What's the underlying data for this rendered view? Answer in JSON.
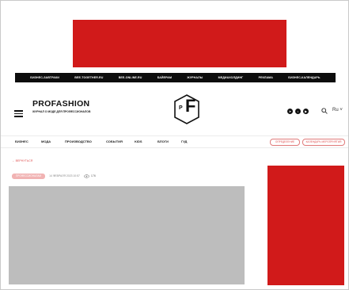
{
  "colors": {
    "ad_block": "#d11a1a",
    "topbar_bg": "#0d0d0d",
    "accent": "#e05555",
    "hero_placeholder": "#bdbdbd"
  },
  "topbar": {
    "links": [
      "БИЗНЕС-ЗАВТРАКИ",
      "BEE-TOGETHER.RU",
      "BEE-ONLINE.RU",
      "БАЙЕРАМ",
      "ЖУРНАЛЫ",
      "МЕДИАХОЛДИНГ",
      "РЕКЛАМА",
      "БИЗНЕС-КАЛЕНДАРЬ"
    ]
  },
  "header": {
    "logo_title": "PROFASHION",
    "logo_subtitle": "ЖУРНАЛ О МОДЕ ДЛЯ ПРОФЕССИОНАЛОВ",
    "emblem_letter_small": "P",
    "emblem_letter_big": "F",
    "social_icons": [
      "telegram-icon",
      "vk-icon",
      "youtube-icon"
    ],
    "lang": "Ru ˅"
  },
  "nav": {
    "items": [
      "БИЗНЕС",
      "МОДА",
      "ПРОИЗВОДСТВО",
      "СОБЫТИЯ",
      "KIDS",
      "БЛОГИ",
      "ГУД"
    ],
    "pill_1": "ОПРЕДЕЛЕНИЕ",
    "pill_2": "КАЛЕНДАРЬ МЕРОПРИЯТИЙ"
  },
  "article": {
    "back_link": "← ВЕРНУТЬСЯ",
    "tag": "ПРОФЕССИОНАЛАМ",
    "date": "14 ФЕВРАЛЯ 2023 10:57",
    "views": "176"
  }
}
